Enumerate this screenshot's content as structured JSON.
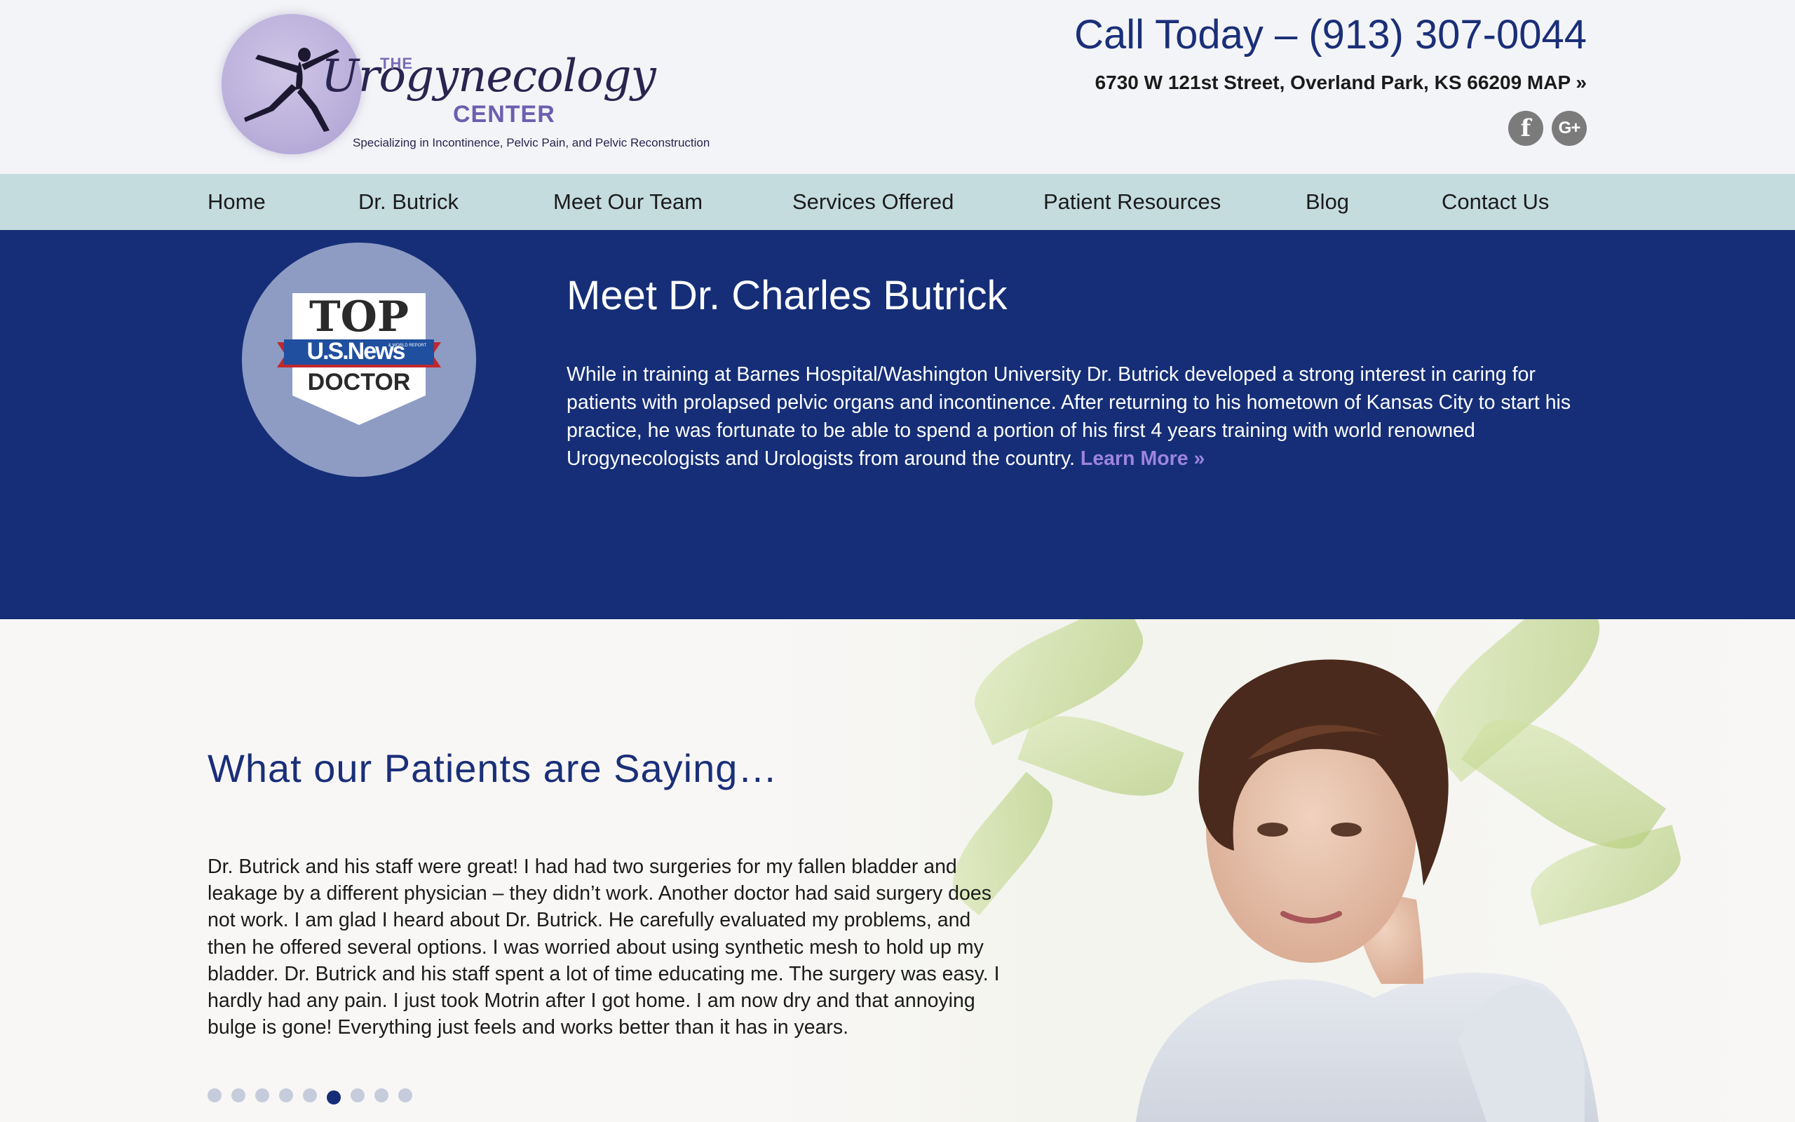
{
  "header": {
    "logo": {
      "the": "THE",
      "name": "Urogynecology",
      "center": "CENTER",
      "tagline": "Specializing in Incontinence, Pelvic Pain, and Pelvic Reconstruction"
    },
    "call": "Call Today – (913) 307-0044",
    "address": "6730 W 121st Street, Overland Park, KS 66209 MAP »",
    "socials": [
      {
        "icon": "facebook-icon",
        "glyph": "f"
      },
      {
        "icon": "google-plus-icon",
        "glyph": "G+"
      }
    ]
  },
  "nav": {
    "items": [
      {
        "label": "Home"
      },
      {
        "label": "Dr. Butrick"
      },
      {
        "label": "Meet Our Team"
      },
      {
        "label": "Services Offered"
      },
      {
        "label": "Patient Resources"
      },
      {
        "label": "Blog"
      },
      {
        "label": "Contact Us"
      }
    ]
  },
  "meet": {
    "badge": {
      "top": "TOP",
      "brand": "U.S.News",
      "small": "& WORLD REPORT",
      "doctor": "DOCTOR"
    },
    "title": "Meet Dr. Charles Butrick",
    "text": "While in training at Barnes Hospital/Washington University Dr. Butrick developed a strong interest in caring for patients with prolapsed pelvic organs and incontinence. After returning to his hometown of Kansas City to start his practice, he was fortunate to be able to spend a portion of his first 4 years training with world renowned Urogynecologists and Urologists from around the country.",
    "learn_more": "Learn More »"
  },
  "testimonials": {
    "title": "What our Patients are Saying…",
    "text": "Dr. Butrick and his staff were great! I had had two surgeries for my fallen bladder and leakage by a different physician – they didn’t work. Another doctor had said surgery does not work. I am glad I heard about Dr. Butrick. He carefully evaluated my problems, and then he offered several options. I was worried about using synthetic mesh to hold up my bladder. Dr. Butrick and his staff spent a lot of time educating me. The surgery was easy. I hardly had any pain. I just took Motrin after I got home. I am now dry and that annoying bulge is gone! Everything just feels and works better than it has in years.",
    "dots_total": 9,
    "active_index": 5
  },
  "colors": {
    "navy": "#152e77",
    "nav_bg": "#c5dcdf",
    "header_bg": "#f3f4f7",
    "accent_purple": "#9d84df",
    "heading_blue": "#1a2f78"
  }
}
